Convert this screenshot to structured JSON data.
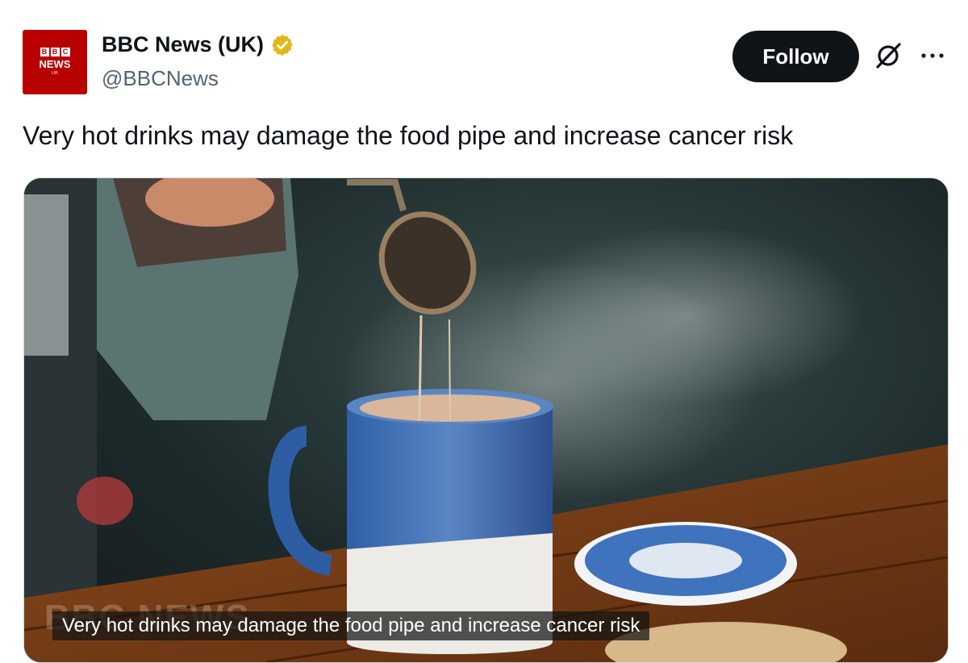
{
  "account": {
    "logo_blocks": [
      "B",
      "B",
      "C"
    ],
    "logo_news": "NEWS",
    "logo_region": "UK",
    "display_name": "BBC News (UK)",
    "handle": "@BBCNews",
    "verified_color": "#e2b719"
  },
  "actions": {
    "follow_label": "Follow"
  },
  "tweet": {
    "text": "Very hot drinks may damage the food pipe and increase cancer risk"
  },
  "media": {
    "caption": "Very hot drinks may damage the food pipe and increase cancer risk",
    "watermark": "BBC NEWS"
  },
  "icons": {
    "verified": "verified-badge-icon",
    "grok": "grok-icon",
    "more": "more-icon"
  }
}
